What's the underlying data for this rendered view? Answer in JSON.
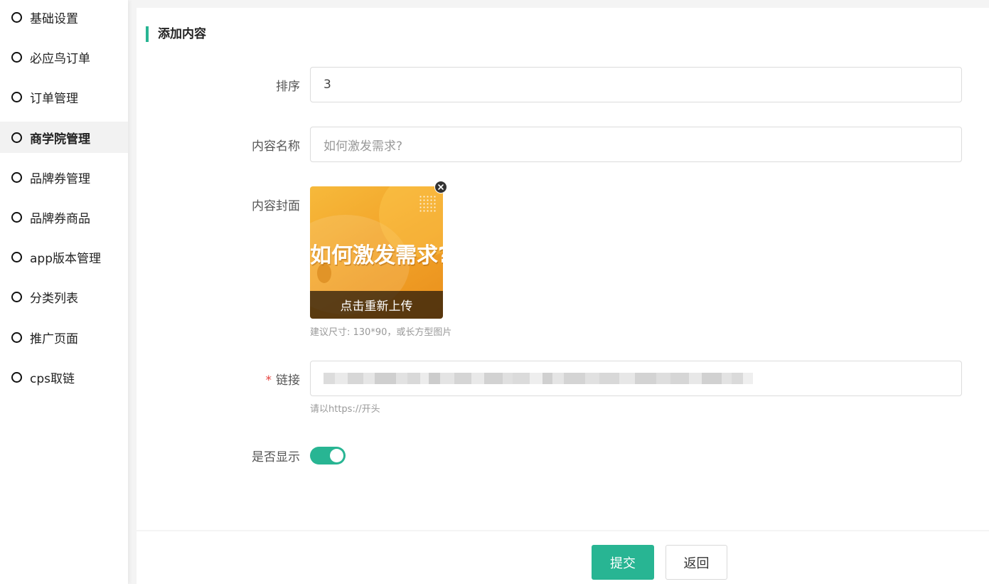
{
  "sidebar": {
    "items": [
      {
        "label": "基础设置"
      },
      {
        "label": "必应鸟订单"
      },
      {
        "label": "订单管理"
      },
      {
        "label": "商学院管理"
      },
      {
        "label": "品牌券管理"
      },
      {
        "label": "品牌券商品"
      },
      {
        "label": "app版本管理"
      },
      {
        "label": "分类列表"
      },
      {
        "label": "推广页面"
      },
      {
        "label": "cps取链"
      }
    ],
    "active_item": "商学院管理"
  },
  "form": {
    "title": "添加内容",
    "sort": {
      "label": "排序",
      "value": "3"
    },
    "name": {
      "label": "内容名称",
      "placeholder": "如何激发需求?"
    },
    "cover": {
      "label": "内容封面",
      "image_text": "如何激发需求?",
      "reupload_label": "点击重新上传",
      "hint": "建议尺寸: 130*90，或长方型图片"
    },
    "link": {
      "required_mark": "*",
      "label": "链接",
      "hint": "请以https://开头"
    },
    "show": {
      "label": "是否显示",
      "on": true
    }
  },
  "footer": {
    "submit_label": "提交",
    "back_label": "返回"
  },
  "colors": {
    "accent": "#28b593",
    "required": "#e5413d"
  }
}
